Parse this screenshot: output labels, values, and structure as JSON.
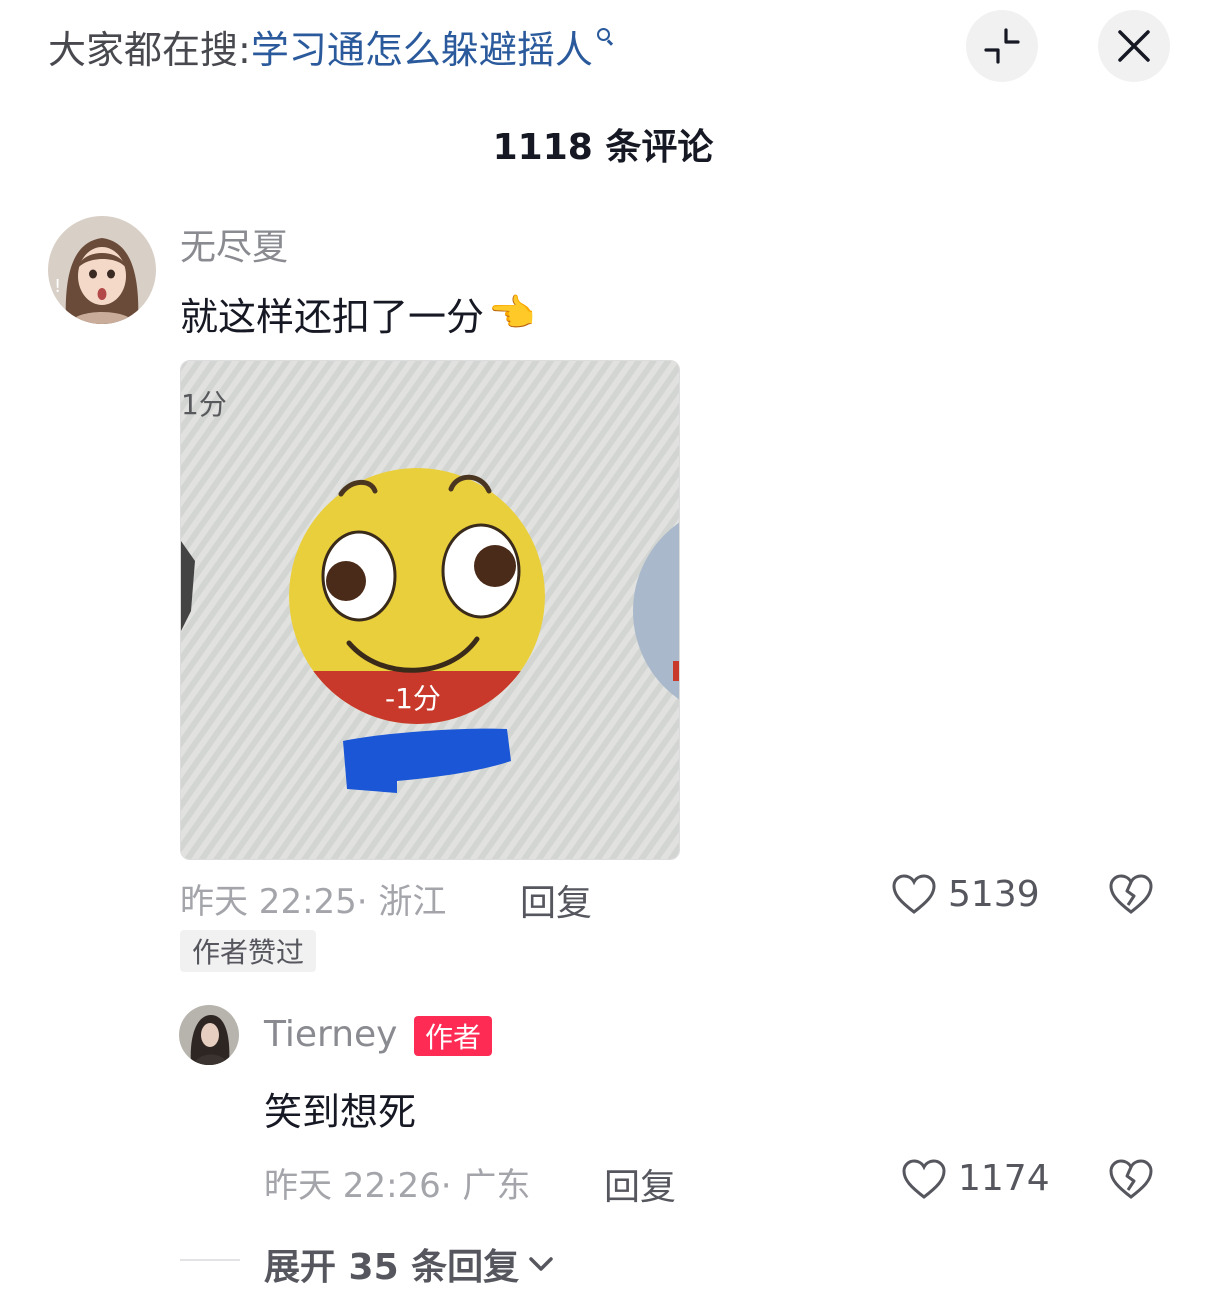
{
  "search": {
    "prefix": "大家都在搜:",
    "query": "学习通怎么躲避摇人"
  },
  "header": {
    "comment_count": "1118 条评论"
  },
  "comments": [
    {
      "username": "无尽夏",
      "text": "就这样还扣了一分",
      "emoji": "👈",
      "image": {
        "corner_label": "1分",
        "emoji_label": "-1分",
        "colors": {
          "face": "#e9cf3c",
          "band": "#c8392b",
          "censor": "#1a56d6"
        }
      },
      "time_location": "昨天 22:25· 浙江",
      "reply_label": "回复",
      "likes": "5139",
      "author_liked_label": "作者赞过",
      "replies": [
        {
          "username": "Tierney",
          "badge": "作者",
          "text": "笑到想死",
          "time_location": "昨天 22:26· 广东",
          "reply_label": "回复",
          "likes": "1174"
        }
      ],
      "expand_label": "展开 35 条回复"
    }
  ],
  "icons": {
    "collapse": "collapse-icon",
    "close": "close-icon",
    "like": "heart-icon",
    "dislike": "broken-heart-icon",
    "expand": "chevron-down-icon",
    "search": "search-icon"
  },
  "colors": {
    "accent": "#fe2c55",
    "link": "#2a5a9c",
    "text_primary": "#161823",
    "text_secondary": "#8a8b91"
  }
}
